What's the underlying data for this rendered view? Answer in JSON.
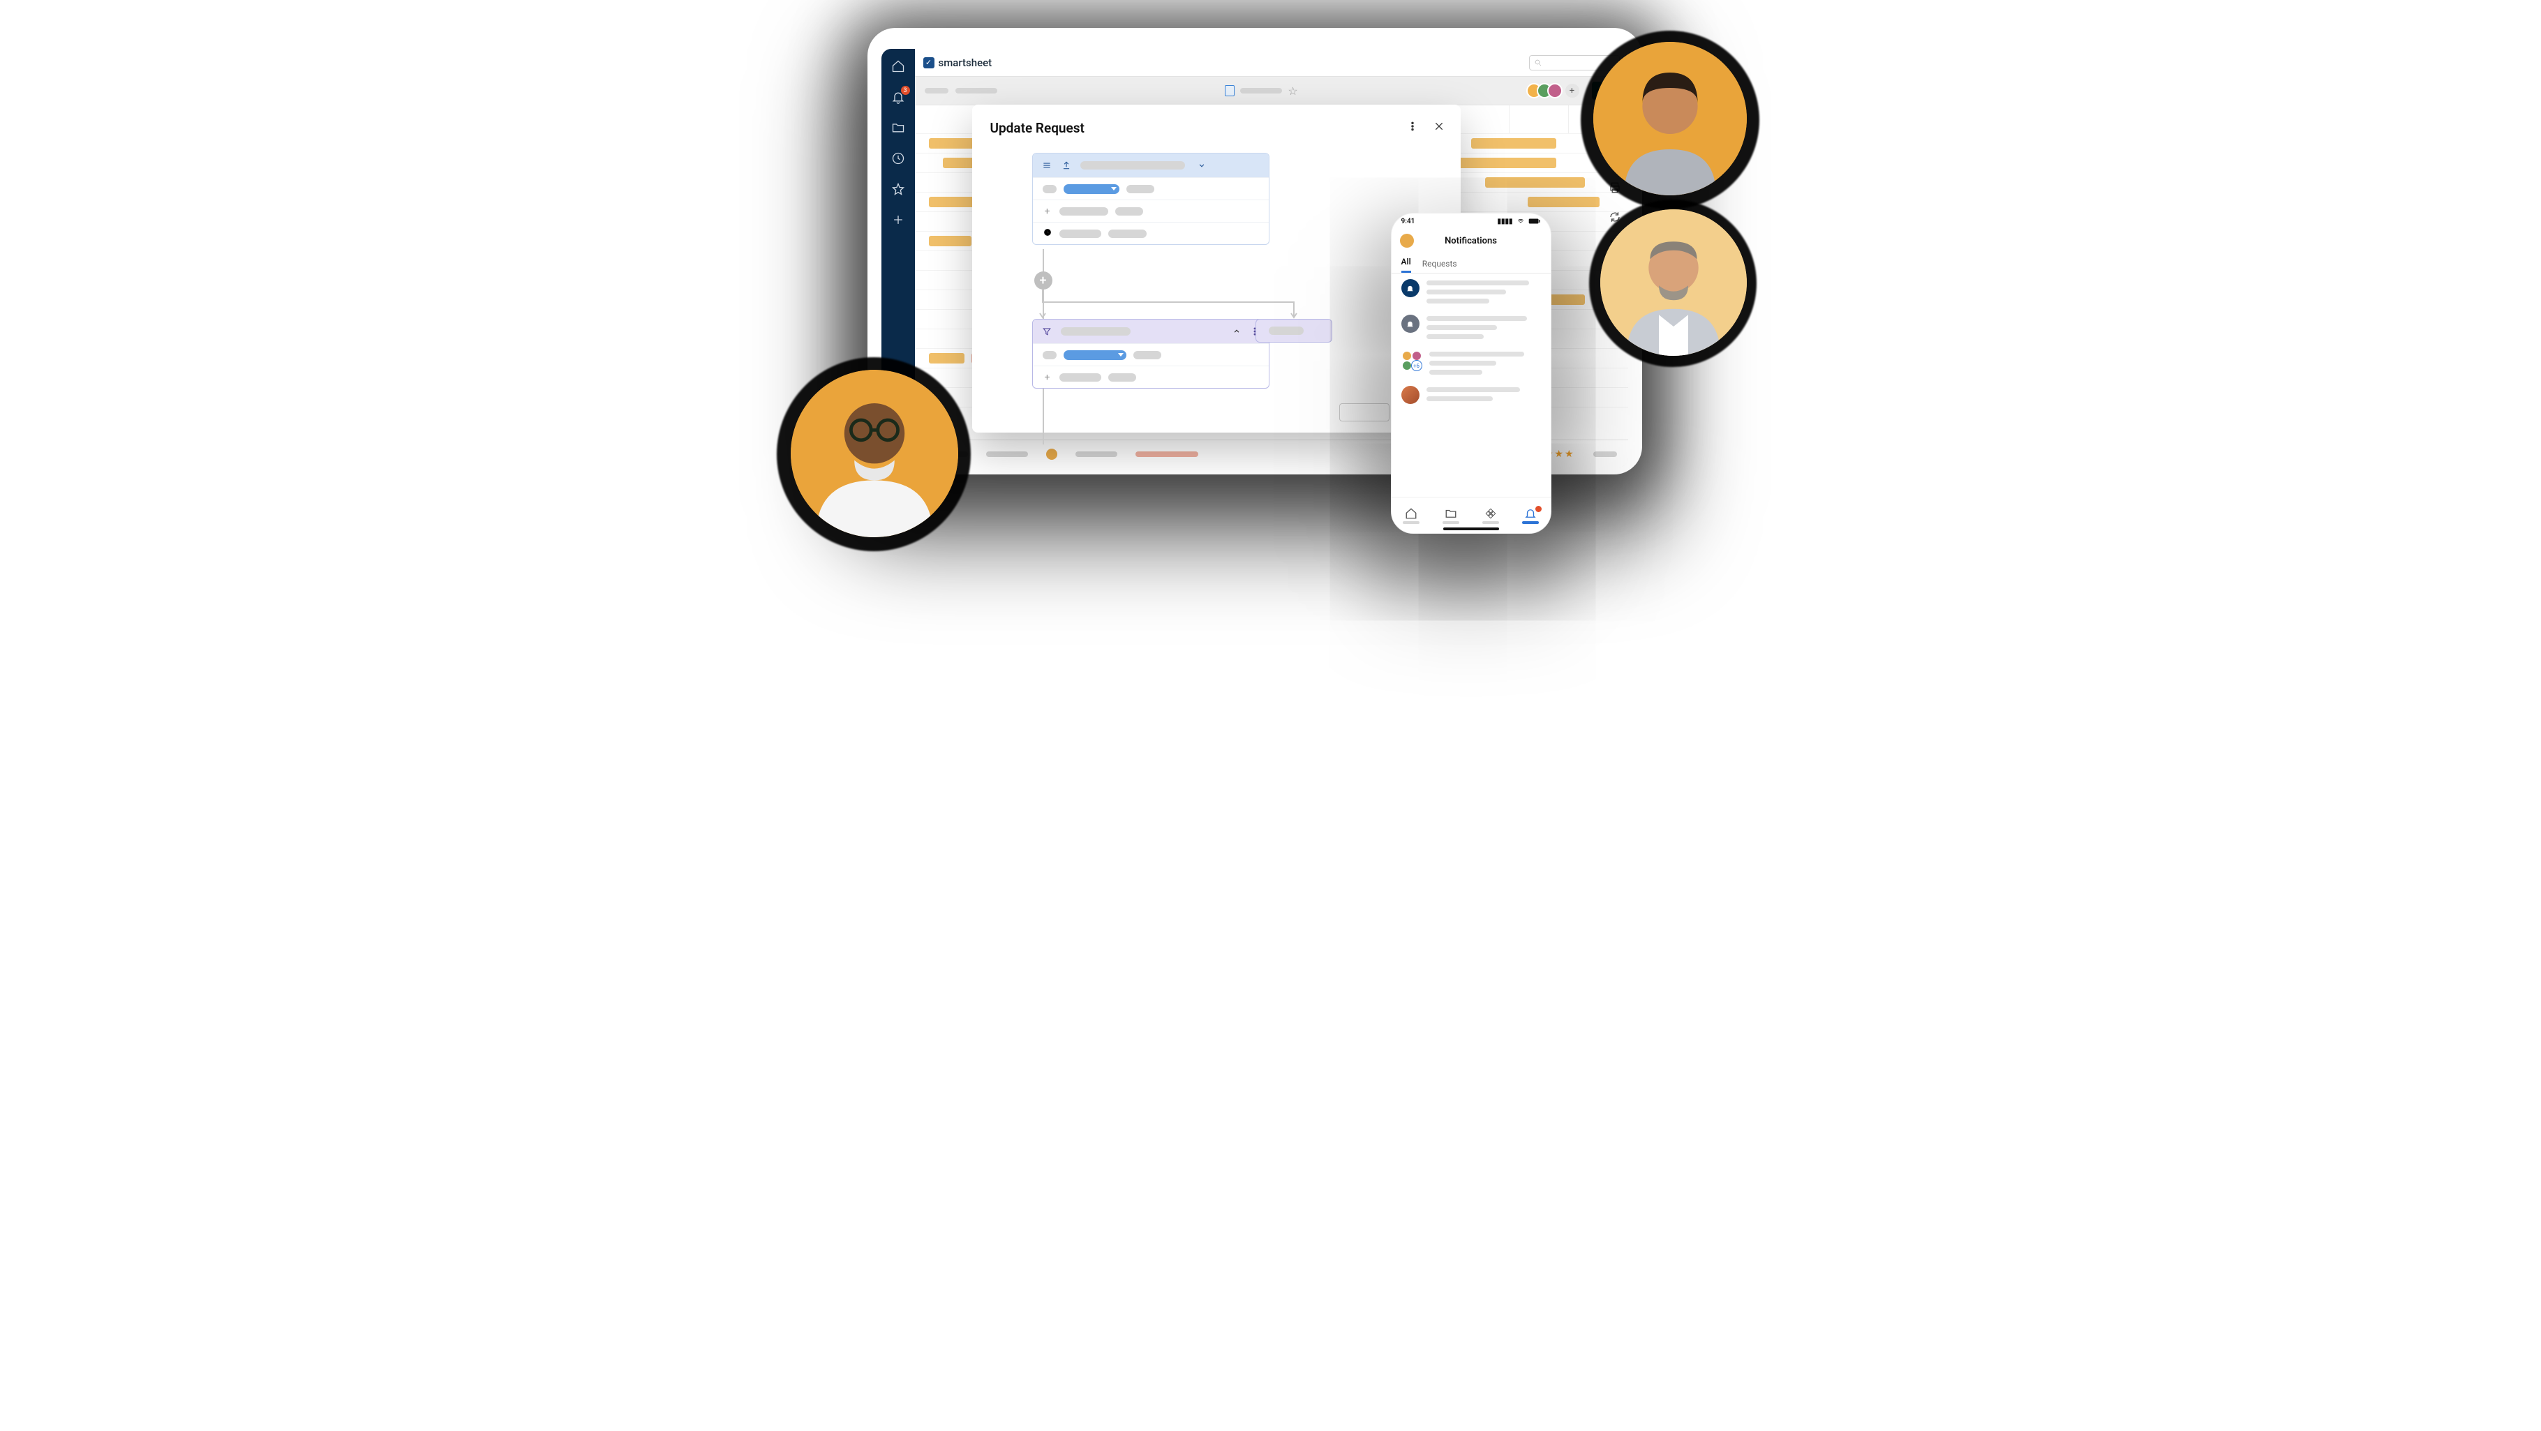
{
  "brand": {
    "name": "smartsheet",
    "mark_glyph": "✓"
  },
  "sidebar": {
    "items": [
      {
        "name": "home-icon"
      },
      {
        "name": "bell-icon",
        "badge": "3"
      },
      {
        "name": "folder-icon"
      },
      {
        "name": "clock-icon"
      },
      {
        "name": "star-icon"
      },
      {
        "name": "add-icon"
      }
    ]
  },
  "topbar": {
    "search_placeholder": ""
  },
  "rightrail": {
    "items": [
      {
        "name": "print-icon"
      },
      {
        "name": "refresh-icon"
      },
      {
        "name": "add-doc-icon"
      }
    ]
  },
  "modal": {
    "title": "Update Request"
  },
  "phone": {
    "time": "9:41",
    "title": "Notifications",
    "tabs": [
      "All",
      "Requests"
    ],
    "active_tab": "All",
    "more_badge": "+6"
  },
  "avatars": [
    "avatar-1",
    "avatar-2",
    "avatar-3"
  ],
  "bubbles": [
    {
      "name": "person-top-right",
      "bg": "#e9a43a"
    },
    {
      "name": "person-middle-right",
      "bg": "#f3cf8c"
    },
    {
      "name": "person-bottom-left",
      "bg": "#eaa43b"
    }
  ]
}
